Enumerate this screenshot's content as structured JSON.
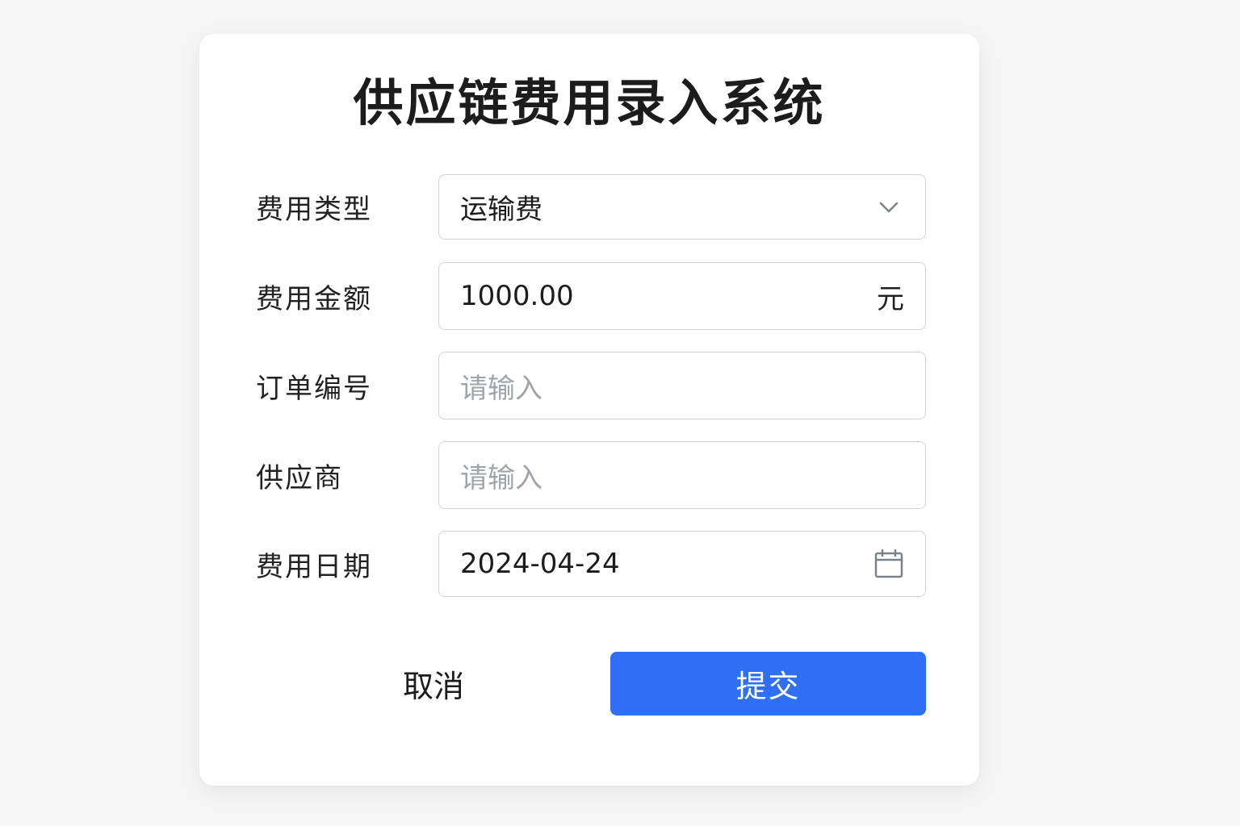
{
  "form": {
    "title": "供应链费用录入系统",
    "fields": {
      "expense_type": {
        "label": "费用类型",
        "value": "运输费",
        "icon": "chevron-down-icon"
      },
      "amount": {
        "label": "费用金额",
        "value": "1000.00",
        "suffix": "元"
      },
      "order_no": {
        "label": "订单编号",
        "placeholder": "请输入"
      },
      "supplier": {
        "label": "供应商",
        "placeholder": "请输入"
      },
      "date": {
        "label": "费用日期",
        "value": "2024-04-24",
        "icon": "calendar-icon"
      }
    },
    "buttons": {
      "cancel": "取消",
      "submit": "提交"
    }
  },
  "colors": {
    "primary": "#2f6ff5",
    "background": "#f5f5f6",
    "card": "#ffffff",
    "border": "#cfd3d8",
    "placeholder": "#a0a4aa"
  }
}
